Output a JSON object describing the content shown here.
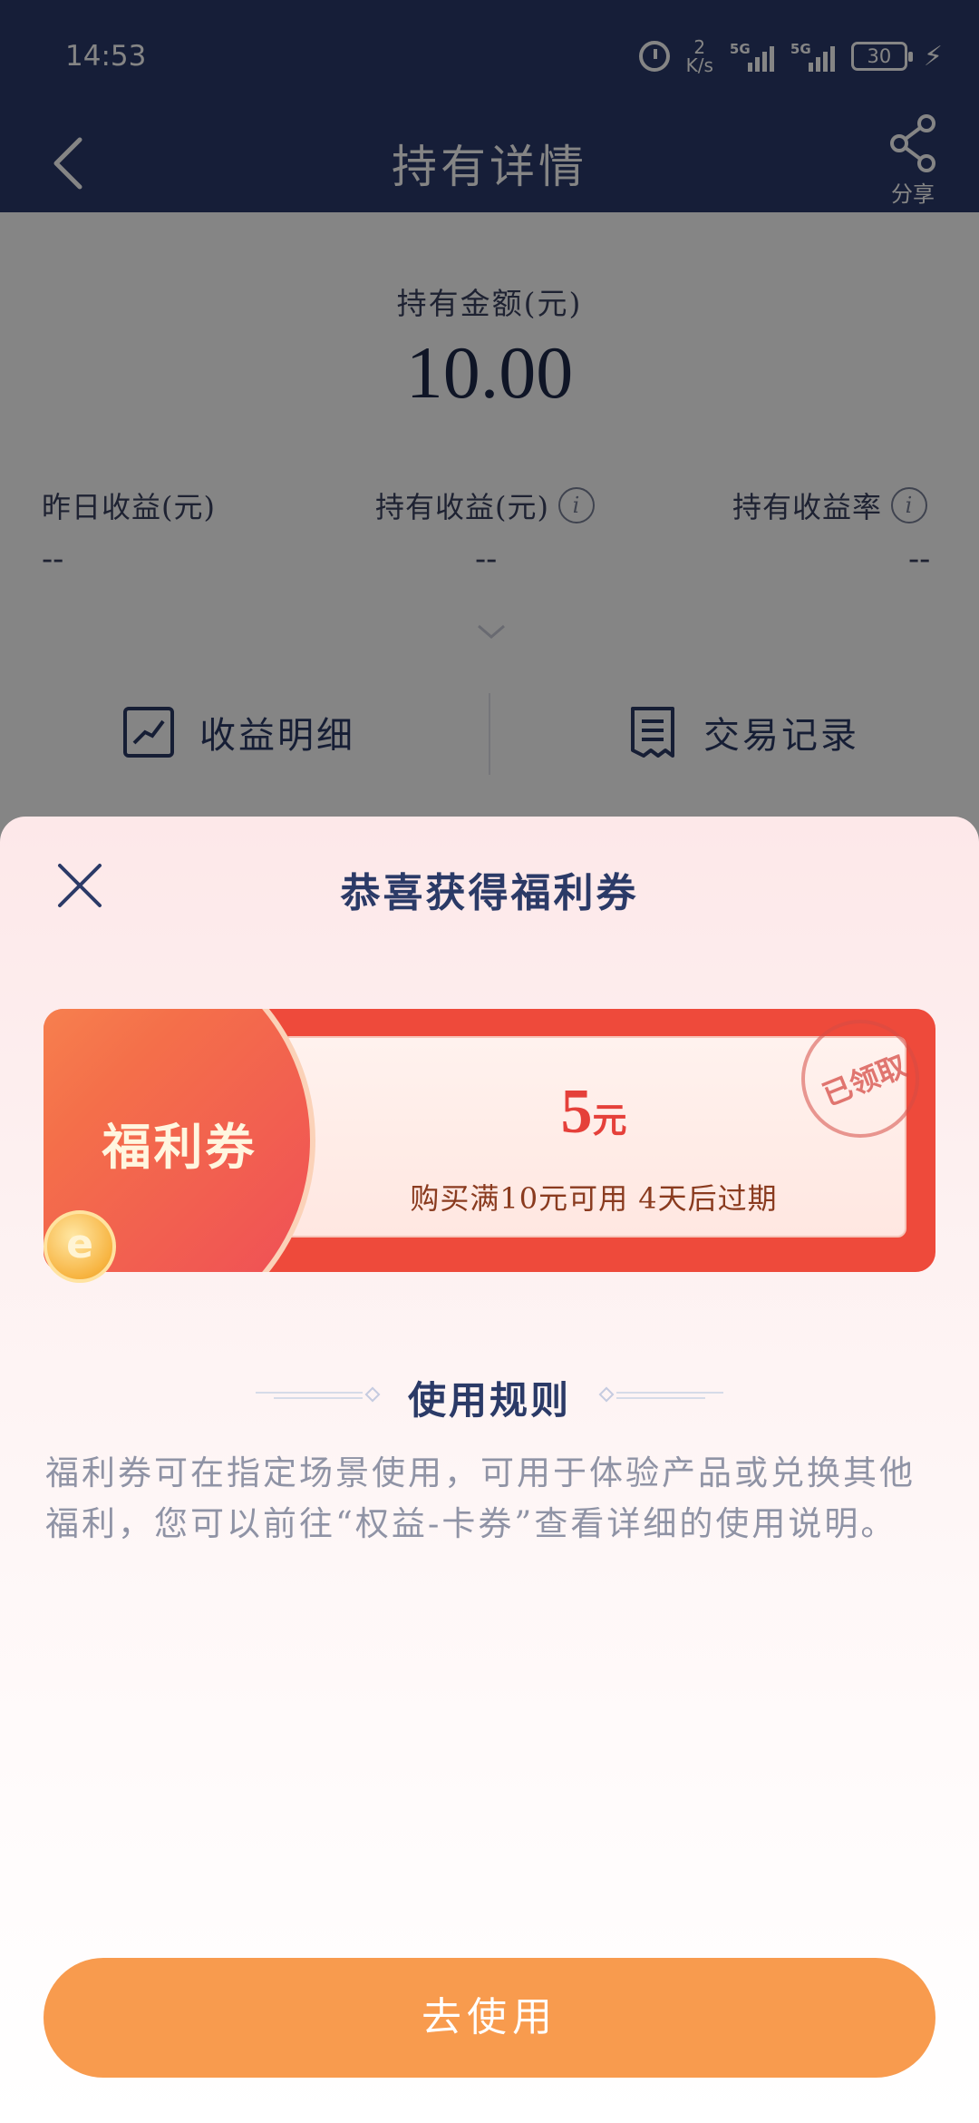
{
  "status_bar": {
    "time": "14:53",
    "net_speed_value": "2",
    "net_speed_unit": "K/s",
    "signal_label_1": "5G",
    "signal_label_2": "5G",
    "battery": "30"
  },
  "navbar": {
    "title": "持有详情",
    "share_label": "分享"
  },
  "holding": {
    "amount_label": "持有金额(元)",
    "amount": "10.00",
    "stats": [
      {
        "label": "昨日收益(元)",
        "value": "--"
      },
      {
        "label": "持有收益(元)",
        "value": "--"
      },
      {
        "label": "持有收益率",
        "value": "--"
      }
    ],
    "actions": [
      {
        "label": "收益明细",
        "icon": "trend-chart-icon"
      },
      {
        "label": "交易记录",
        "icon": "receipt-icon"
      }
    ]
  },
  "sheet": {
    "title": "恭喜获得福利券",
    "coupon": {
      "name": "福利券",
      "amount": "5",
      "unit": "元",
      "condition": "购买满10元可用 4天后过期",
      "stamp": "已领取"
    },
    "rules_title": "使用规则",
    "rules_text": "福利券可在指定场景使用，可用于体验产品或兑换其他福利，您可以前往“权益-卡券”查看详细的使用说明。",
    "use_button": "去使用"
  },
  "colors": {
    "nav_bg": "#2b3a6b",
    "accent_orange": "#f89b4e",
    "coupon_red": "#ee4a3b"
  }
}
